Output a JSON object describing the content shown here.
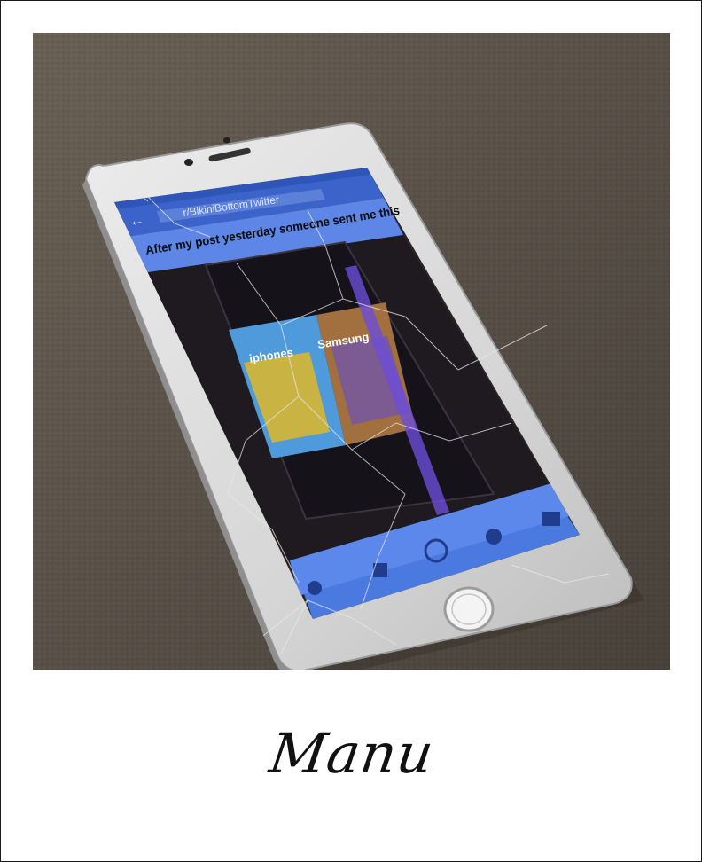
{
  "photo": {
    "subreddit": "r/BikiniBottomTwitter",
    "post_title": "After my post yesterday someone sent me this",
    "meme_left_label": "iphones",
    "meme_right_label": "Samsung"
  },
  "caption": "Manu"
}
